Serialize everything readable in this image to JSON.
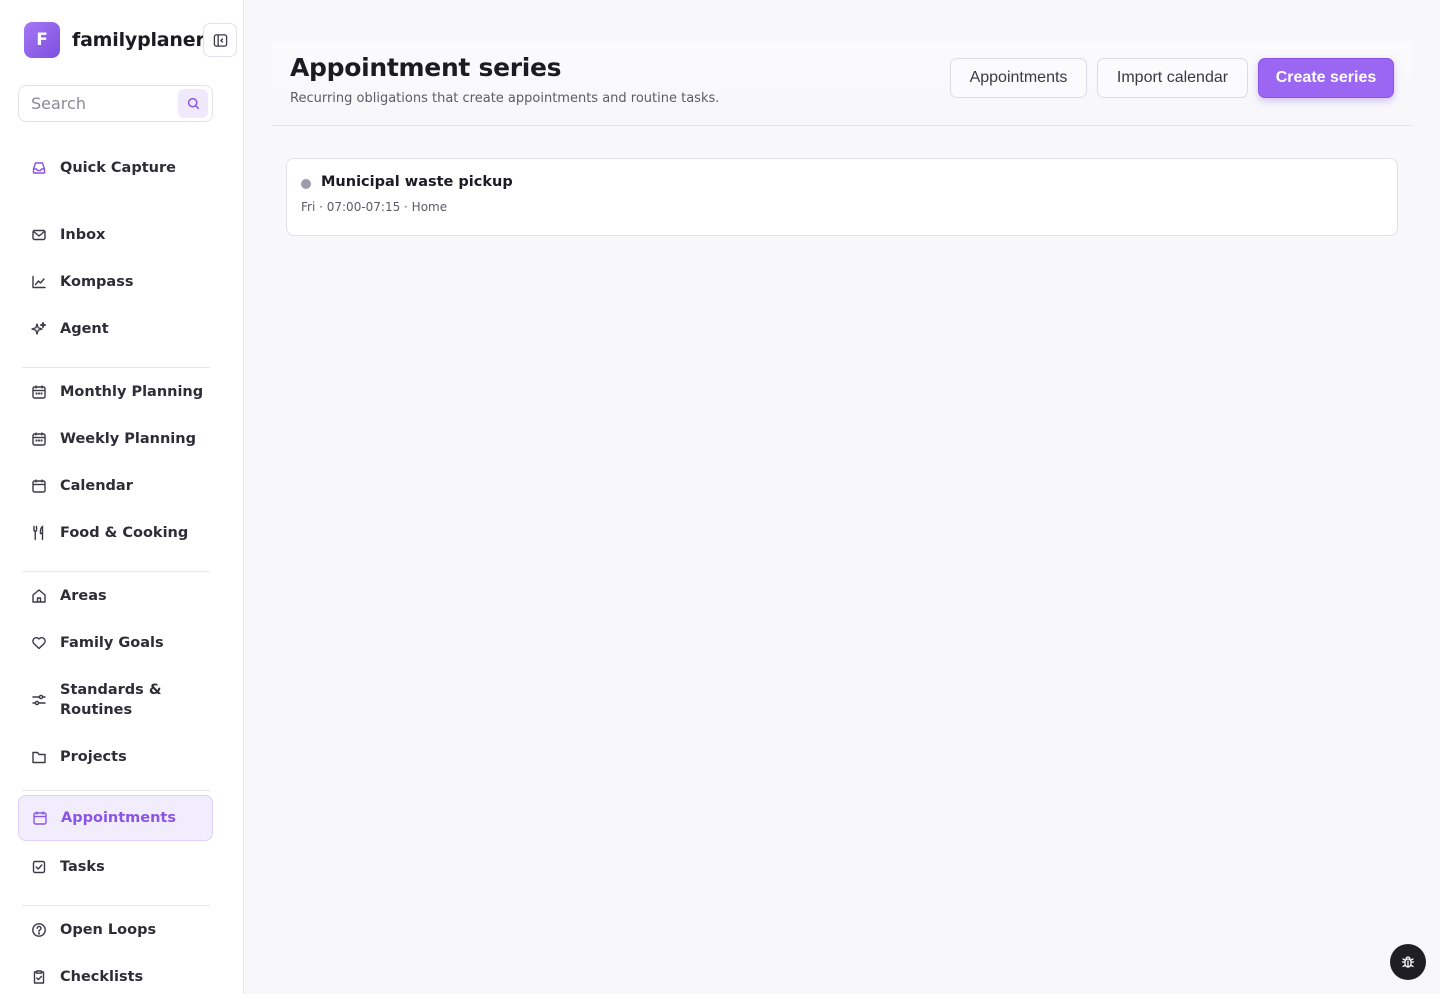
{
  "app": {
    "logo_letter": "F",
    "name": "familyplaner"
  },
  "search": {
    "placeholder": "Search",
    "value": ""
  },
  "sidebar": {
    "items": [
      {
        "label": "Quick Capture",
        "icon": "inbox-tray-icon"
      },
      {
        "label": "Inbox",
        "icon": "mail-icon"
      },
      {
        "label": "Kompass",
        "icon": "line-chart-icon"
      },
      {
        "label": "Agent",
        "icon": "sparkles-icon"
      },
      {
        "label": "Monthly Planning",
        "icon": "calendar-icon"
      },
      {
        "label": "Weekly Planning",
        "icon": "calendar-icon"
      },
      {
        "label": "Calendar",
        "icon": "calendar-icon"
      },
      {
        "label": "Food & Cooking",
        "icon": "utensils-icon"
      },
      {
        "label": "Areas",
        "icon": "home-icon"
      },
      {
        "label": "Family Goals",
        "icon": "heart-icon"
      },
      {
        "label": "Standards & Routines",
        "icon": "sliders-icon"
      },
      {
        "label": "Projects",
        "icon": "folder-icon"
      },
      {
        "label": "Appointments",
        "icon": "calendar-icon",
        "active": true
      },
      {
        "label": "Tasks",
        "icon": "check-square-icon"
      },
      {
        "label": "Open Loops",
        "icon": "help-circle-icon"
      },
      {
        "label": "Checklists",
        "icon": "clipboard-check-icon"
      }
    ]
  },
  "header": {
    "title": "Appointment series",
    "subtitle": "Recurring obligations that create appointments and routine tasks.",
    "appointments_label": "Appointments",
    "import_label": "Import calendar",
    "create_label": "Create series"
  },
  "series": [
    {
      "title": "Municipal waste pickup",
      "meta": "Fri · 07:00-07:15 · Home"
    }
  ],
  "colors": {
    "accent": "#9a66f2",
    "accent_dark": "#8a55e6",
    "active_bg": "#f2edfd",
    "text": "#1c1b22",
    "series_dot": "#9e9aaa"
  }
}
